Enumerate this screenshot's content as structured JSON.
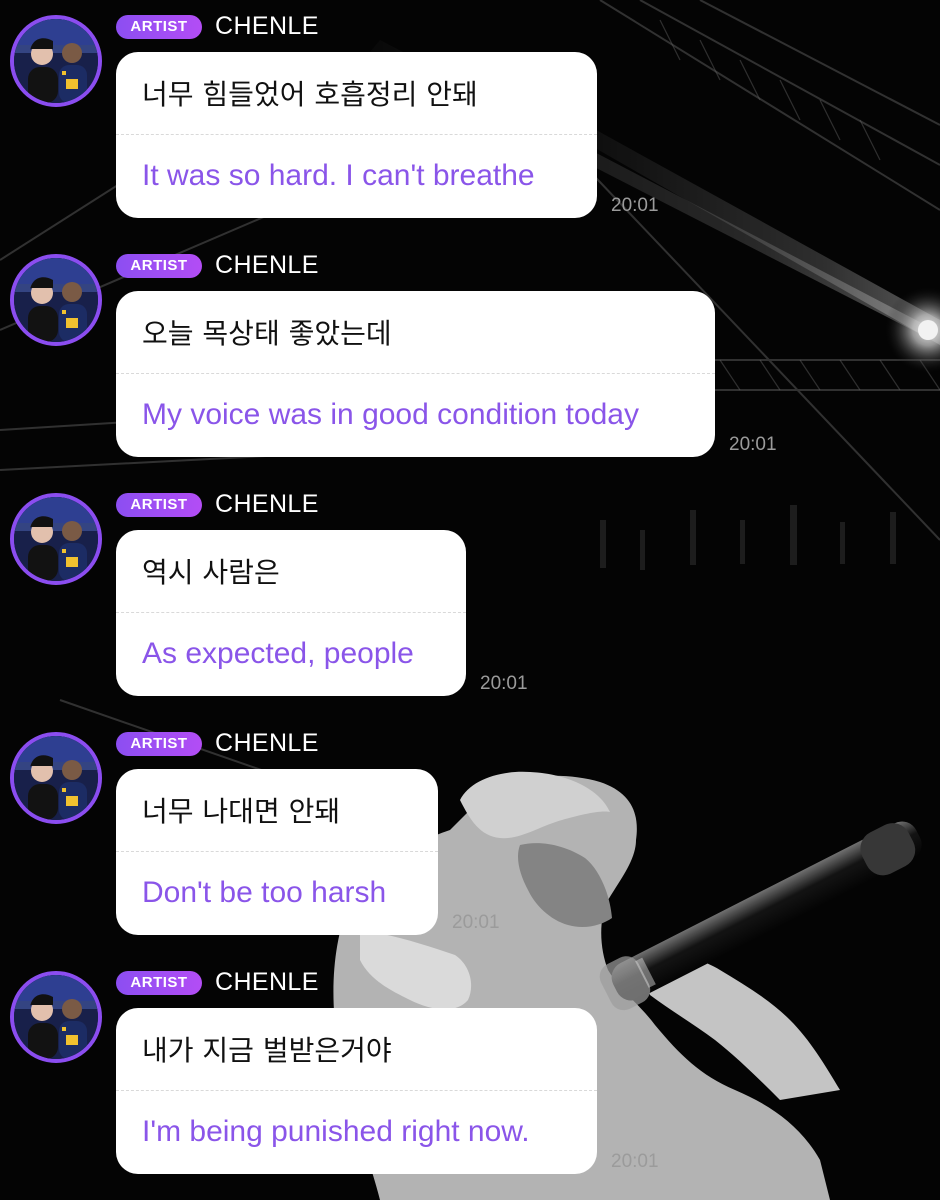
{
  "messages": [
    {
      "badge": "ARTIST",
      "name": "CHENLE",
      "korean": "너무 힘들었어 호흡정리 안돼",
      "translation": "It was so hard. I can't breathe",
      "time": "20:01"
    },
    {
      "badge": "ARTIST",
      "name": "CHENLE",
      "korean": "오늘 목상태 좋았는데",
      "translation": "My voice was in good condition today",
      "time": "20:01"
    },
    {
      "badge": "ARTIST",
      "name": "CHENLE",
      "korean": "역시 사람은",
      "translation": "As expected, people",
      "time": "20:01"
    },
    {
      "badge": "ARTIST",
      "name": "CHENLE",
      "korean": "너무 나대면 안돼",
      "translation": "Don't be too harsh",
      "time": "20:01"
    },
    {
      "badge": "ARTIST",
      "name": "CHENLE",
      "korean": "내가 지금 벌받은거야",
      "translation": "I'm being punished right now.",
      "time": "20:01"
    }
  ],
  "colors": {
    "background": "#000000",
    "bubble": "#ffffff",
    "korean_text": "#111111",
    "translation_text": "#8a55e9",
    "badge_gradient_start": "#8c4ef2",
    "badge_gradient_end": "#b34df5",
    "avatar_ring": "#8b4df0",
    "timestamp": "#9b9b9b"
  },
  "icons": {
    "avatar": "profile-photo"
  }
}
